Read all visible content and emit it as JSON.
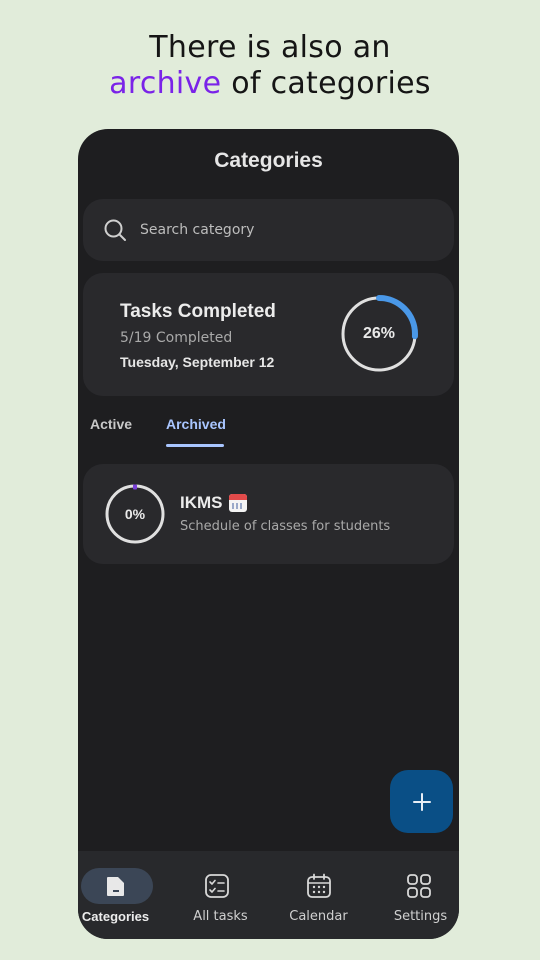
{
  "promo": {
    "line1": "There is also an",
    "accent": "archive",
    "line2_rest": " of categories",
    "accent_color": "#7a23e8"
  },
  "header": {
    "title": "Categories"
  },
  "search": {
    "placeholder": "Search category",
    "icon": "search-icon"
  },
  "summary": {
    "title": "Tasks Completed",
    "count_text": "5/19 Completed",
    "date": "Tuesday, September 12",
    "percent_label": "26%",
    "progress": 0.26,
    "progress_color": "#4a98e8"
  },
  "tabs": [
    {
      "label": "Active",
      "selected": false
    },
    {
      "label": "Archived",
      "selected": true
    }
  ],
  "categories": [
    {
      "name": "IKMS",
      "emoji_icon": "calendar-emoji-icon",
      "description": "Schedule of classes for students",
      "percent_label": "0%",
      "progress": 0,
      "accent_color": "#7a3fd8"
    }
  ],
  "fab": {
    "icon": "plus-icon"
  },
  "nav": [
    {
      "label": "Categories",
      "icon": "folder-icon",
      "selected": true
    },
    {
      "label": "All tasks",
      "icon": "checklist-icon",
      "selected": false
    },
    {
      "label": "Calendar",
      "icon": "calendar-icon",
      "selected": false
    },
    {
      "label": "Settings",
      "icon": "grid-icon",
      "selected": false
    }
  ]
}
